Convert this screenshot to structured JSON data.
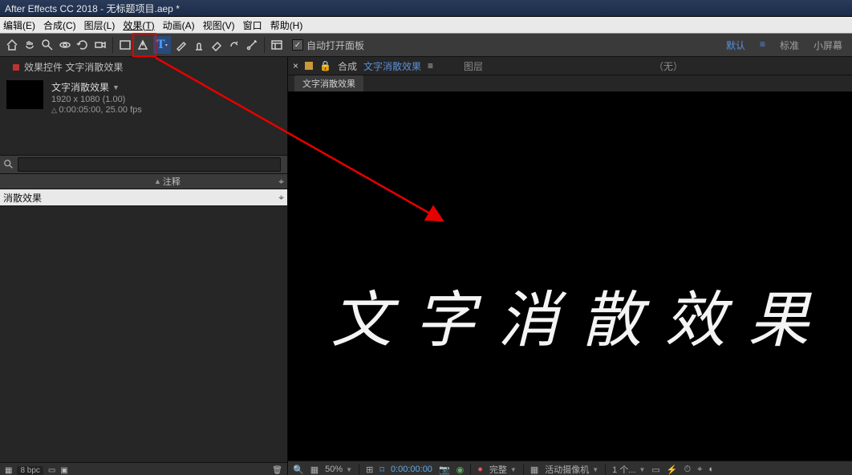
{
  "titlebar": "After Effects CC 2018 - 无标题项目.aep *",
  "menu": {
    "edit": "编辑(E)",
    "comp": "合成(C)",
    "layer": "图层(L)",
    "effect": "效果(T)",
    "anim": "动画(A)",
    "view": "视图(V)",
    "window": "窗口",
    "help": "帮助(H)"
  },
  "toolbar": {
    "auto_open": "自动打开面板",
    "workspace": {
      "default": "默认",
      "standard": "标准",
      "small": "小屏幕"
    }
  },
  "effects_panel": {
    "title": "效果控件 文字消散效果"
  },
  "project": {
    "name": "文字消散效果",
    "dims": "1920 x 1080 (1.00)",
    "time": "0:00:05:00, 25.00 fps"
  },
  "cols": {
    "comment": "注释"
  },
  "item": {
    "name": "消散效果"
  },
  "footer": {
    "bpc": "8 bpc"
  },
  "comp_header": {
    "lock": "🔒",
    "label": "合成",
    "name": "文字消散效果",
    "hamburger": "≡",
    "layer_label": "图层",
    "layer_none": "（无）"
  },
  "comp_tab": "文字消散效果",
  "canvas_text": "文字消散效果",
  "viewer_footer": {
    "zoom": "50%",
    "timecode": "0:00:00:00",
    "full": "完整",
    "camera": "活动摄像机",
    "views": "1 个..."
  }
}
